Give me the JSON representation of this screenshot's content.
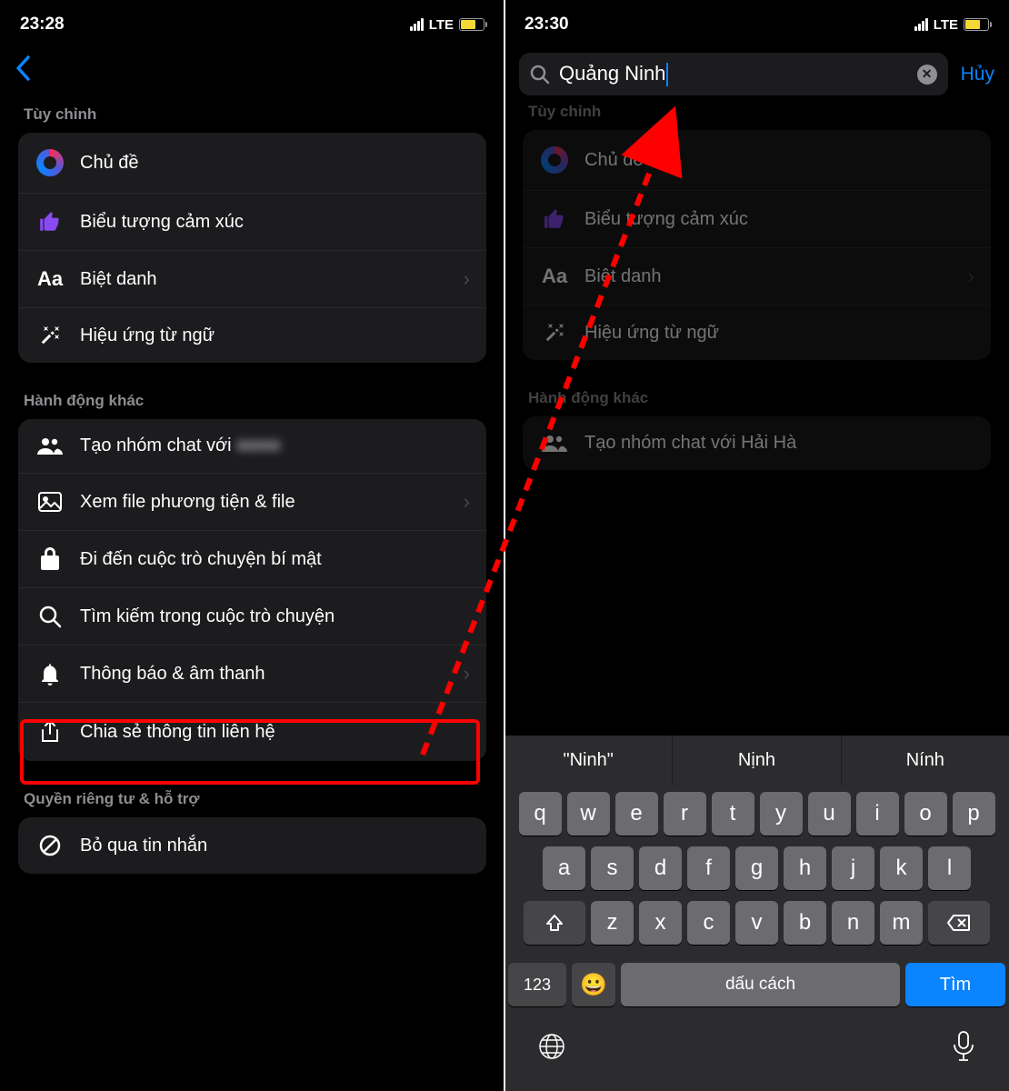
{
  "left": {
    "status": {
      "time": "23:28",
      "lte": "LTE"
    },
    "sections": {
      "customize": {
        "title": "Tùy chỉnh",
        "theme": "Chủ đề",
        "emoji": "Biểu tượng cảm xúc",
        "nickname": "Biệt danh",
        "word_effects": "Hiệu ứng từ ngữ"
      },
      "more_actions": {
        "title": "Hành động khác",
        "create_group_prefix": "Tạo nhóm chat với",
        "view_media": "Xem file phương tiện & file",
        "secret": "Đi đến cuộc trò chuyện bí mật",
        "search_conv": "Tìm kiếm trong cuộc trò chuyện",
        "notifications": "Thông báo & âm thanh",
        "share_contact": "Chia sẻ thông tin liên hệ"
      },
      "privacy": {
        "title": "Quyền riêng tư & hỗ trợ",
        "ignore": "Bỏ qua tin nhắn"
      }
    }
  },
  "right": {
    "status": {
      "time": "23:30",
      "lte": "LTE"
    },
    "search": {
      "value": "Quảng Ninh",
      "cancel": "Hủy"
    },
    "sections": {
      "customize": {
        "title": "Tùy chỉnh",
        "theme": "Chủ đề",
        "emoji": "Biểu tượng cảm xúc",
        "nickname": "Biệt danh",
        "word_effects": "Hiệu ứng từ ngữ"
      },
      "more_actions": {
        "title": "Hành động khác",
        "create_group": "Tạo nhóm chat với Hải Hà"
      }
    },
    "keyboard": {
      "suggestions": [
        "\"Ninh\"",
        "Nịnh",
        "Nính"
      ],
      "row1": [
        "q",
        "w",
        "e",
        "r",
        "t",
        "y",
        "u",
        "i",
        "o",
        "p"
      ],
      "row2": [
        "a",
        "s",
        "d",
        "f",
        "g",
        "h",
        "j",
        "k",
        "l"
      ],
      "row3": [
        "z",
        "x",
        "c",
        "v",
        "b",
        "n",
        "m"
      ],
      "num_key": "123",
      "space": "dấu cách",
      "return": "Tìm"
    }
  }
}
